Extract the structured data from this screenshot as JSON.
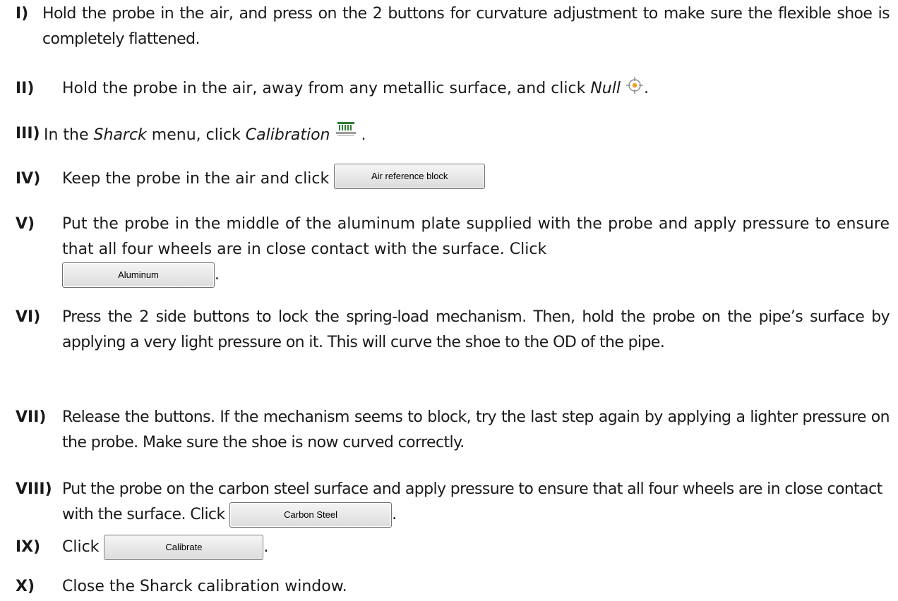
{
  "steps": [
    {
      "num": "I)",
      "text": "Hold the probe in the air, and press on the 2 buttons for curvature adjustment to make sure the flexible shoe is completely flattened."
    },
    {
      "num": "II)",
      "text_before": "Hold the probe in the air, away from any metallic surface, and click ",
      "ital": "Null",
      "text_after": "."
    },
    {
      "num": "III)",
      "text_a": "In the ",
      "ital_a": "Sharck",
      "text_b": " menu, click ",
      "ital_b": "Calibration",
      "text_after": "."
    },
    {
      "num": "IV)",
      "text_before": "Keep the probe in the air and click ",
      "button": "Air reference block"
    },
    {
      "num": "V)",
      "text_before": "Put the probe in the middle of the aluminum plate supplied with the probe and apply pressure to ensure that all four wheels are in close contact with the surface. Click",
      "button": "Aluminum",
      "text_after": "."
    },
    {
      "num": "VI)",
      "text": "Press the 2 side buttons to lock the spring-load mechanism. Then, hold the probe on the pipe’s surface by applying a very light pressure on it. This will curve the shoe to the OD of the pipe."
    },
    {
      "num": "VII)",
      "text": "Release the buttons. If the mechanism seems to block, try the last step again by applying a lighter pressure on the probe. Make sure the shoe is now curved correctly."
    },
    {
      "num": "VIII)",
      "text_before": "Put the probe on the carbon steel surface and apply pressure to ensure that all four wheels are in close contact with the surface. Click ",
      "button": "Carbon Steel",
      "text_after": "."
    },
    {
      "num": "IX)",
      "text_before": "Click ",
      "button": "Calibrate",
      "text_after": "."
    },
    {
      "num": "X)",
      "text": "Close the Sharck calibration window."
    }
  ],
  "icons": {
    "null": "null-crosshair-icon",
    "calibration": "calibration-icon",
    "null_dot_color": "#f0a020",
    "calibration_color": "#2e7d32"
  }
}
